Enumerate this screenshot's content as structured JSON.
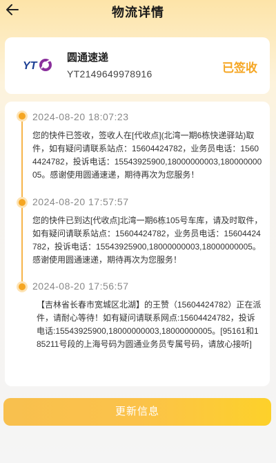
{
  "header": {
    "title": "物流详情"
  },
  "carrier": {
    "logo_text": "YTO",
    "name": "圆通速递",
    "tracking_number": "YT2149649978916",
    "status": "已签收"
  },
  "timeline": [
    {
      "time": "2024-08-20 18:07:23",
      "text": "您的快件已签收，签收人在[代收点](北湾一期6栋快递驿站)取件，如有疑问请联系站点：15604424782，业务员电话：15604424782，投诉电话：15543925900,18000000003,18000000005。感谢使用圆通速递，期待再次为您服务！"
    },
    {
      "time": "2024-08-20 17:57:57",
      "text": "您的快件已到达[代收点]北湾一期6栋105号车库，请及时取件，如有疑问请联系站点：15604424782，业务员电话：15604424782，投诉电话：15543925900,18000000003,18000000005。感谢使用圆通速递，期待再次为您服务！"
    },
    {
      "time": "2024-08-20 17:56:57",
      "text": "【吉林省长春市宽城区北湖】的王赞（15604424782）正在派件，请耐心等待！如有疑问请联系网点:15604424782，投诉电话:15543925900,18000000003,18000000005。[95161和185211号段的上海号码为圆通业务员专属号码，请放心接听]"
    }
  ],
  "actions": {
    "refresh_label": "更新信息"
  },
  "colors": {
    "accent": "#f5a623",
    "logo_blue": "#1c3f94",
    "logo_purple": "#8a2f9c"
  }
}
